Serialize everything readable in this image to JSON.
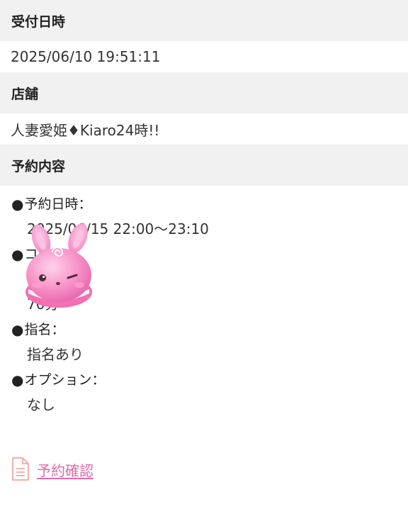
{
  "reception": {
    "label": "受付日時",
    "value": "2025/06/10 19:51:11"
  },
  "store": {
    "label": "店舗",
    "value": "人妻愛姫♦Kiaro24時!!"
  },
  "reservation": {
    "label": "予約内容",
    "bullet": "●",
    "fields": [
      {
        "label": "予約日時：",
        "value": "2025/06/15 22:00〜23:10"
      },
      {
        "label": "コース：",
        "value": "70分"
      },
      {
        "label": "指名：",
        "value": "指名あり"
      },
      {
        "label": "オプション：",
        "value": "なし"
      }
    ]
  },
  "confirm_link": {
    "label": "予約確認"
  },
  "colors": {
    "section_bg": "#f1f1f1",
    "link": "#e06aa8",
    "mascot_pink": "#f58fc4"
  }
}
